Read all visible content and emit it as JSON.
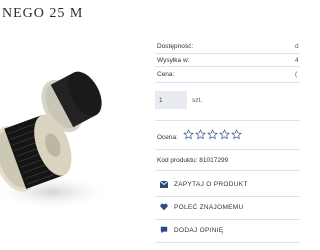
{
  "product": {
    "title": "NEGO 25 M",
    "image_alt": "product-photo"
  },
  "info": {
    "availability_label": "Dostępność:",
    "availability_value": "d",
    "shipping_label": "Wysyłka w:",
    "shipping_value": "4",
    "price_label": "Cena:",
    "price_value": "("
  },
  "quantity": {
    "value": "1",
    "unit": "szt."
  },
  "rating": {
    "label": "Ocena:",
    "stars_total": 5,
    "stars_filled": 0
  },
  "code": {
    "label": "Kod produktu:",
    "value": "81017299"
  },
  "actions": {
    "ask": "ZAPYTAJ O PRODUKT",
    "recommend": "POLEĆ ZNAJOMEMU",
    "review": "DODAJ OPINIĘ"
  },
  "colors": {
    "accent": "#2c4a7c",
    "divider": "#dde3ea",
    "input_bg": "#e8ecf2"
  }
}
